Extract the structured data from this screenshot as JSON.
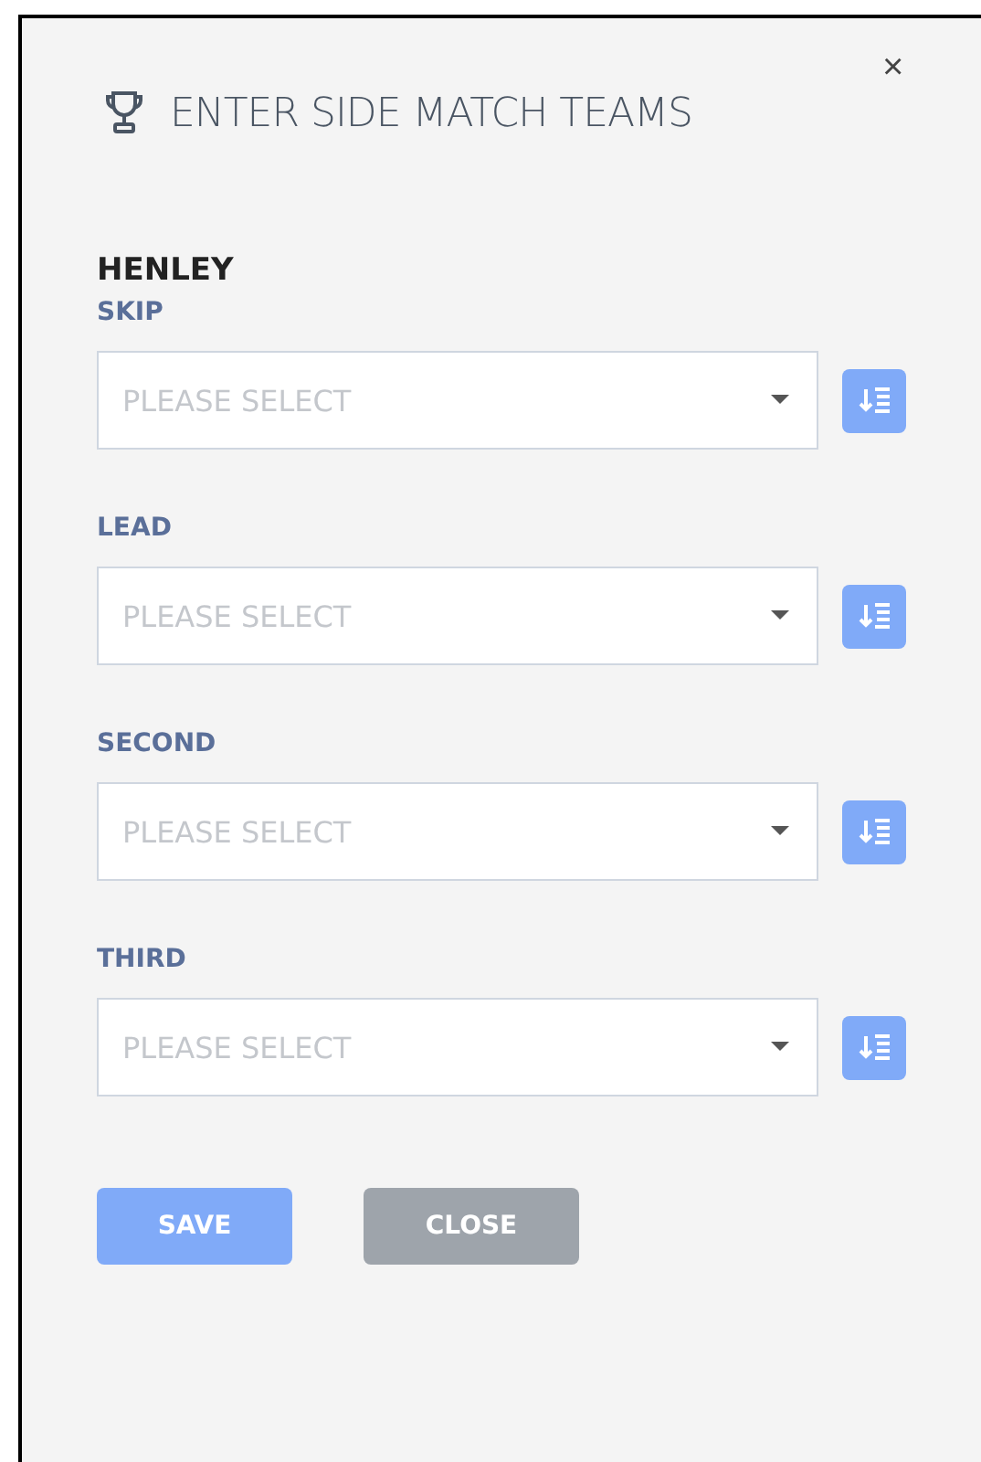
{
  "dialog": {
    "title": "ENTER SIDE MATCH TEAMS",
    "close": "×"
  },
  "team": "HENLEY",
  "positions": [
    {
      "label": "SKIP",
      "placeholder": "PLEASE SELECT"
    },
    {
      "label": "LEAD",
      "placeholder": "PLEASE SELECT"
    },
    {
      "label": "SECOND",
      "placeholder": "PLEASE SELECT"
    },
    {
      "label": "THIRD",
      "placeholder": "PLEASE SELECT"
    }
  ],
  "buttons": [
    {
      "label": "SAVE",
      "kind": "primary"
    },
    {
      "label": "CLOSE",
      "kind": "secondary"
    }
  ]
}
